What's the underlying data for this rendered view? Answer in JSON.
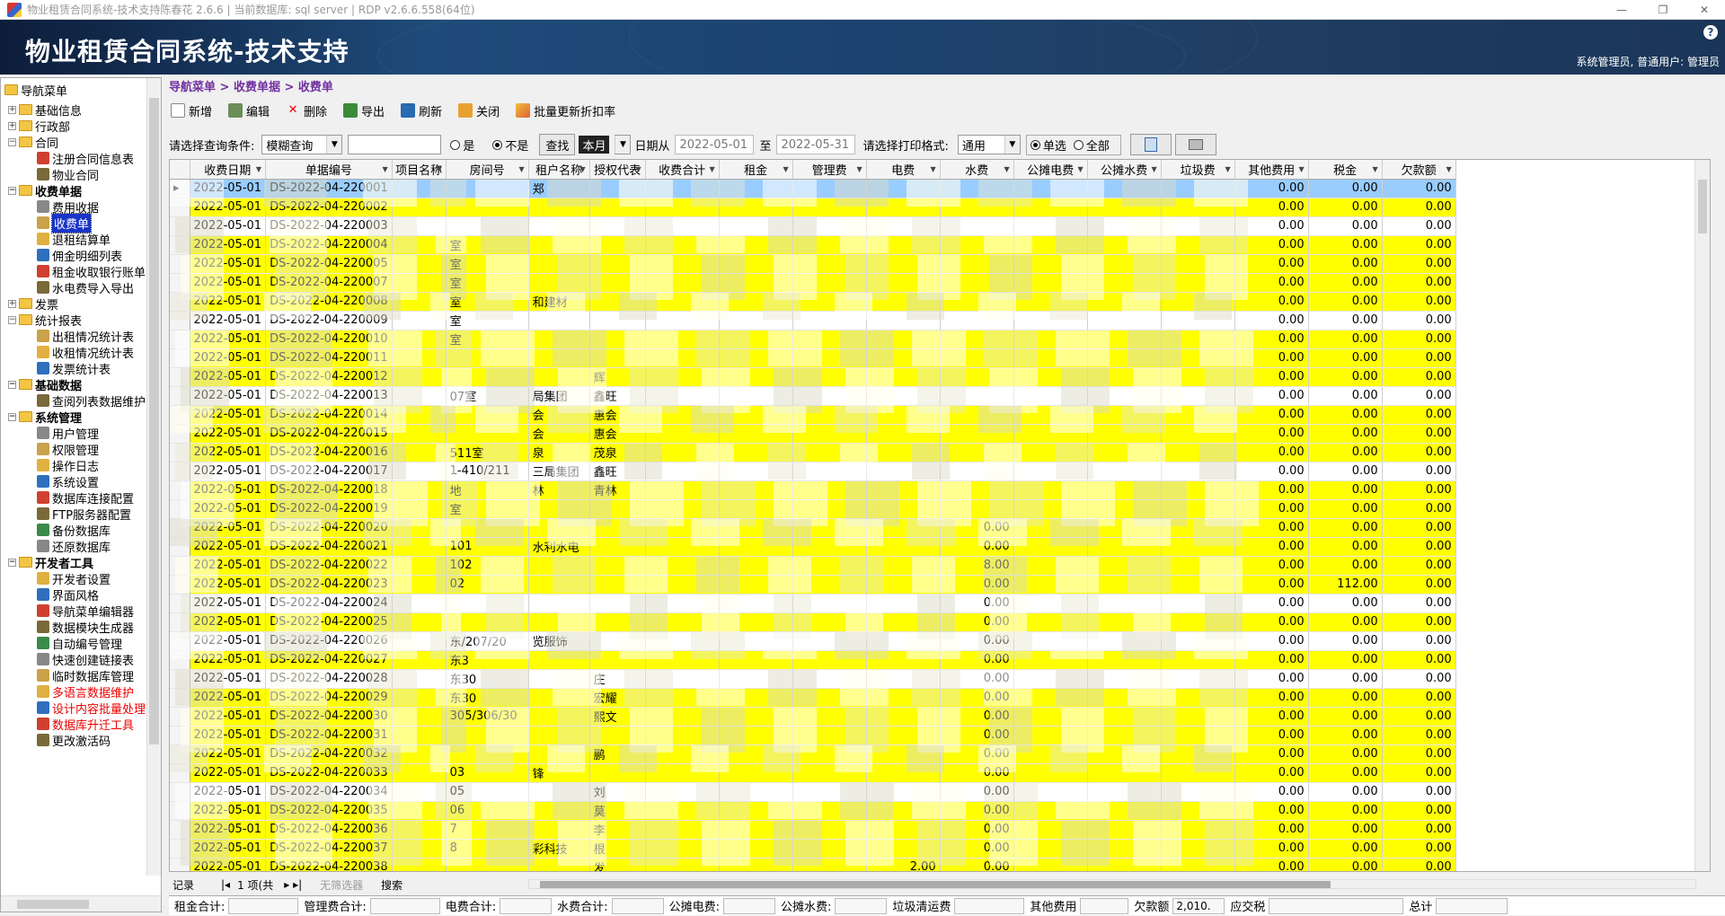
{
  "window": {
    "title": "物业租赁合同系统-技术支持陈春花 2.6.6 | 当前数据库: sql server | RDP v2.6.6.558(64位)"
  },
  "banner": {
    "title": "物业租赁合同系统-技术支持",
    "user_info": "系统管理员, 普通用户: 管理员"
  },
  "sidebar": {
    "root": "导航菜单",
    "items": [
      {
        "label": "基础信息",
        "level": 1,
        "type": "folder"
      },
      {
        "label": "行政部",
        "level": 1,
        "type": "folder"
      },
      {
        "label": "合同",
        "level": 1,
        "type": "folder"
      },
      {
        "label": "注册合同信息表",
        "level": 2,
        "type": "leaf"
      },
      {
        "label": "物业合同",
        "level": 2,
        "type": "leaf"
      },
      {
        "label": "收费单据",
        "level": 1,
        "type": "folder"
      },
      {
        "label": "费用收据",
        "level": 2,
        "type": "leaf"
      },
      {
        "label": "收费单",
        "level": 2,
        "type": "leaf",
        "selected": true
      },
      {
        "label": "退租结算单",
        "level": 2,
        "type": "leaf"
      },
      {
        "label": "佣金明细列表",
        "level": 2,
        "type": "leaf"
      },
      {
        "label": "租金收取银行账单",
        "level": 2,
        "type": "leaf"
      },
      {
        "label": "水电费导入导出",
        "level": 2,
        "type": "leaf"
      },
      {
        "label": "发票",
        "level": 1,
        "type": "folder"
      },
      {
        "label": "统计报表",
        "level": 1,
        "type": "folder"
      },
      {
        "label": "出租情况统计表",
        "level": 2,
        "type": "leaf"
      },
      {
        "label": "收租情况统计表",
        "level": 2,
        "type": "leaf"
      },
      {
        "label": "发票统计表",
        "level": 2,
        "type": "leaf"
      },
      {
        "label": "基础数据",
        "level": 1,
        "type": "folder"
      },
      {
        "label": "查阅列表数据维护",
        "level": 2,
        "type": "leaf"
      },
      {
        "label": "系统管理",
        "level": 1,
        "type": "folder"
      },
      {
        "label": "用户管理",
        "level": 2,
        "type": "leaf"
      },
      {
        "label": "权限管理",
        "level": 2,
        "type": "leaf"
      },
      {
        "label": "操作日志",
        "level": 2,
        "type": "leaf"
      },
      {
        "label": "系统设置",
        "level": 2,
        "type": "leaf"
      },
      {
        "label": "数据库连接配置",
        "level": 2,
        "type": "leaf"
      },
      {
        "label": "FTP服务器配置",
        "level": 2,
        "type": "leaf"
      },
      {
        "label": "备份数据库",
        "level": 2,
        "type": "leaf"
      },
      {
        "label": "还原数据库",
        "level": 2,
        "type": "leaf"
      },
      {
        "label": "开发者工具",
        "level": 1,
        "type": "folder"
      },
      {
        "label": "开发者设置",
        "level": 2,
        "type": "leaf"
      },
      {
        "label": "界面风格",
        "level": 2,
        "type": "leaf"
      },
      {
        "label": "导航菜单编辑器",
        "level": 2,
        "type": "leaf"
      },
      {
        "label": "数据模块生成器",
        "level": 2,
        "type": "leaf"
      },
      {
        "label": "自动编号管理",
        "level": 2,
        "type": "leaf"
      },
      {
        "label": "快速创建链接表",
        "level": 2,
        "type": "leaf"
      },
      {
        "label": "临时数据库管理",
        "level": 2,
        "type": "leaf"
      },
      {
        "label": "多语言数据维护",
        "level": 2,
        "type": "leaf",
        "red": true
      },
      {
        "label": "设计内容批量处理",
        "level": 2,
        "type": "leaf",
        "red": true
      },
      {
        "label": "数据库升迁工具",
        "level": 2,
        "type": "leaf",
        "red": true
      },
      {
        "label": "更改激活码",
        "level": 2,
        "type": "leaf"
      }
    ]
  },
  "breadcrumb": "导航菜单 > 收费单据 > 收费单",
  "toolbar": {
    "new": "新增",
    "edit": "编辑",
    "delete": "删除",
    "export": "导出",
    "refresh": "刷新",
    "close": "关闭",
    "batch": "批量更新折扣率"
  },
  "filter": {
    "label": "请选择查询条件:",
    "mode": "模糊查询",
    "search_value": "",
    "yes": "是",
    "no": "不是",
    "no_checked": true,
    "search_button": "查找",
    "this_month": "本月",
    "date_from_label": "日期从",
    "date_from": "2022-05-01",
    "date_to_label": "至",
    "date_to": "2022-05-31",
    "print_label": "请选择打印格式:",
    "print_format": "通用",
    "single": "单选",
    "all": "全部"
  },
  "grid": {
    "columns": [
      "收费日期",
      "单据编号",
      "项目名称",
      "房间号",
      "租户名称",
      "授权代表",
      "收费合计",
      "租金",
      "管理费",
      "电费",
      "水费",
      "公摊电费",
      "公摊水费",
      "垃圾费",
      "其他费用",
      "税金",
      "欠款额"
    ],
    "rows": [
      [
        "2022-05-01",
        "DS-2022-04-220001",
        "",
        "",
        "郑",
        "",
        "",
        "",
        "",
        "",
        "",
        "",
        "",
        "",
        "0.00",
        "0.00",
        "0.00"
      ],
      [
        "2022-05-01",
        "DS-2022-04-220002",
        "",
        "",
        "",
        "",
        "",
        "",
        "",
        "",
        "",
        "",
        "",
        "",
        "0.00",
        "0.00",
        "0.00"
      ],
      [
        "2022-05-01",
        "DS-2022-04-220003",
        "",
        "",
        "",
        "",
        "",
        "",
        "",
        "",
        "",
        "",
        "",
        "",
        "0.00",
        "0.00",
        "0.00"
      ],
      [
        "2022-05-01",
        "DS-2022-04-220004",
        "",
        "室",
        "",
        "",
        "",
        "",
        "",
        "",
        "",
        "",
        "",
        "",
        "0.00",
        "0.00",
        "0.00"
      ],
      [
        "2022-05-01",
        "DS-2022-04-220005",
        "",
        "室",
        "",
        "",
        "",
        "",
        "",
        "",
        "",
        "",
        "",
        "",
        "0.00",
        "0.00",
        "0.00"
      ],
      [
        "2022-05-01",
        "DS-2022-04-220007",
        "",
        "室",
        "",
        "",
        "",
        "",
        "",
        "",
        "",
        "",
        "",
        "",
        "0.00",
        "0.00",
        "0.00"
      ],
      [
        "2022-05-01",
        "DS-2022-04-220008",
        "",
        "室",
        "和建材",
        "",
        "",
        "",
        "",
        "",
        "",
        "",
        "",
        "",
        "0.00",
        "0.00",
        "0.00"
      ],
      [
        "2022-05-01",
        "DS-2022-04-220009",
        "",
        "室",
        "",
        "",
        "",
        "",
        "",
        "",
        "",
        "",
        "",
        "",
        "0.00",
        "0.00",
        "0.00"
      ],
      [
        "2022-05-01",
        "DS-2022-04-220010",
        "",
        "室",
        "",
        "",
        "",
        "",
        "",
        "",
        "",
        "",
        "",
        "",
        "0.00",
        "0.00",
        "0.00"
      ],
      [
        "2022-05-01",
        "DS-2022-04-220011",
        "",
        "",
        "",
        "",
        "",
        "",
        "",
        "",
        "",
        "",
        "",
        "",
        "0.00",
        "0.00",
        "0.00"
      ],
      [
        "2022-05-01",
        "DS-2022-04-220012",
        "",
        "",
        "",
        "辉",
        "",
        "",
        "",
        "",
        "",
        "",
        "",
        "",
        "0.00",
        "0.00",
        "0.00"
      ],
      [
        "2022-05-01",
        "DS-2022-04-220013",
        "",
        "07室",
        "局集团",
        "鑫旺",
        "",
        "",
        "",
        "",
        "",
        "",
        "",
        "",
        "0.00",
        "0.00",
        "0.00"
      ],
      [
        "2022-05-01",
        "DS-2022-04-220014",
        "",
        "",
        "会",
        "惠会",
        "",
        "",
        "",
        "",
        "",
        "",
        "",
        "",
        "0.00",
        "0.00",
        "0.00"
      ],
      [
        "2022-05-01",
        "DS-2022-04-220015",
        "",
        "",
        "会",
        "惠会",
        "",
        "",
        "",
        "",
        "",
        "",
        "",
        "",
        "0.00",
        "0.00",
        "0.00"
      ],
      [
        "2022-05-01",
        "DS-2022-04-220016",
        "",
        "511室",
        "泉",
        "茂泉",
        "",
        "",
        "",
        "",
        "",
        "",
        "",
        "",
        "0.00",
        "0.00",
        "0.00"
      ],
      [
        "2022-05-01",
        "DS-2022-04-220017",
        "",
        "1-410/211",
        "三局集团",
        "鑫旺",
        "",
        "",
        "",
        "",
        "",
        "",
        "",
        "",
        "0.00",
        "0.00",
        "0.00"
      ],
      [
        "2022-05-01",
        "DS-2022-04-220018",
        "",
        "地",
        "林",
        "青林",
        "",
        "",
        "",
        "",
        "",
        "",
        "",
        "",
        "0.00",
        "0.00",
        "0.00"
      ],
      [
        "2022-05-01",
        "DS-2022-04-220019",
        "",
        "室",
        "",
        "",
        "",
        "",
        "",
        "",
        "",
        "",
        "",
        "",
        "0.00",
        "0.00",
        "0.00"
      ],
      [
        "2022-05-01",
        "DS-2022-04-220020",
        "",
        "",
        "",
        "",
        "",
        "",
        "",
        "",
        "0.00",
        "",
        "",
        "",
        "0.00",
        "0.00",
        "0.00"
      ],
      [
        "2022-05-01",
        "DS-2022-04-220021",
        "",
        "101",
        "水利水电",
        "",
        "",
        "",
        "",
        "",
        "0.00",
        "",
        "",
        "",
        "0.00",
        "0.00",
        "0.00"
      ],
      [
        "2022-05-01",
        "DS-2022-04-220022",
        "",
        "102",
        "",
        "",
        "",
        "",
        "",
        "",
        "8.00",
        "",
        "",
        "",
        "0.00",
        "0.00",
        "0.00"
      ],
      [
        "2022-05-01",
        "DS-2022-04-220023",
        "",
        "02",
        "",
        "",
        "",
        "",
        "",
        "",
        "0.00",
        "",
        "",
        "",
        "0.00",
        "112.00",
        "0.00"
      ],
      [
        "2022-05-01",
        "DS-2022-04-220024",
        "",
        "",
        "",
        "",
        "",
        "",
        "",
        "",
        "0.00",
        "",
        "",
        "",
        "0.00",
        "0.00",
        "0.00"
      ],
      [
        "2022-05-01",
        "DS-2022-04-220025",
        "",
        "",
        "",
        "",
        "",
        "",
        "",
        "",
        "0.00",
        "",
        "",
        "",
        "0.00",
        "0.00",
        "0.00"
      ],
      [
        "2022-05-01",
        "DS-2022-04-220026",
        "",
        "东/207/20",
        "览服饰",
        "",
        "",
        "",
        "",
        "",
        "0.00",
        "",
        "",
        "",
        "0.00",
        "0.00",
        "0.00"
      ],
      [
        "2022-05-01",
        "DS-2022-04-220027",
        "",
        "东3",
        "",
        "",
        "",
        "",
        "",
        "",
        "0.00",
        "",
        "",
        "",
        "0.00",
        "0.00",
        "0.00"
      ],
      [
        "2022-05-01",
        "DS-2022-04-220028",
        "",
        "东30",
        "",
        "庄",
        "",
        "",
        "",
        "",
        "0.00",
        "",
        "",
        "",
        "0.00",
        "0.00",
        "0.00"
      ],
      [
        "2022-05-01",
        "DS-2022-04-220029",
        "",
        "东30",
        "",
        "宏耀",
        "",
        "",
        "",
        "",
        "0.00",
        "",
        "",
        "",
        "0.00",
        "0.00",
        "0.00"
      ],
      [
        "2022-05-01",
        "DS-2022-04-220030",
        "",
        "305/306/30",
        "",
        "熙文",
        "",
        "",
        "",
        "",
        "0.00",
        "",
        "",
        "",
        "0.00",
        "0.00",
        "0.00"
      ],
      [
        "2022-05-01",
        "DS-2022-04-220031",
        "",
        "",
        "",
        "",
        "",
        "",
        "",
        "",
        "0.00",
        "",
        "",
        "",
        "0.00",
        "0.00",
        "0.00"
      ],
      [
        "2022-05-01",
        "DS-2022-04-220032",
        "",
        "",
        "",
        "鹏",
        "",
        "",
        "",
        "",
        "0.00",
        "",
        "",
        "",
        "0.00",
        "0.00",
        "0.00"
      ],
      [
        "2022-05-01",
        "DS-2022-04-220033",
        "",
        "03",
        "锋",
        "",
        "",
        "",
        "",
        "",
        "0.00",
        "",
        "",
        "",
        "0.00",
        "0.00",
        "0.00"
      ],
      [
        "2022-05-01",
        "DS-2022-04-220034",
        "",
        "05",
        "",
        "刘",
        "",
        "",
        "",
        "",
        "0.00",
        "",
        "",
        "",
        "0.00",
        "0.00",
        "0.00"
      ],
      [
        "2022-05-01",
        "DS-2022-04-220035",
        "",
        "06",
        "",
        "莫",
        "",
        "",
        "",
        "",
        "0.00",
        "",
        "",
        "",
        "0.00",
        "0.00",
        "0.00"
      ],
      [
        "2022-05-01",
        "DS-2022-04-220036",
        "",
        "7",
        "",
        "李",
        "",
        "",
        "",
        "",
        "0.00",
        "",
        "",
        "",
        "0.00",
        "0.00",
        "0.00"
      ],
      [
        "2022-05-01",
        "DS-2022-04-220037",
        "",
        "8",
        "彩科技",
        "根",
        "",
        "",
        "",
        "",
        "0.00",
        "",
        "",
        "",
        "0.00",
        "0.00",
        "0.00"
      ],
      [
        "2022-05-01",
        "DS-2022-04-220038",
        "",
        "",
        "",
        "发",
        "",
        "",
        "",
        "2.00",
        "0.00",
        "",
        "",
        "",
        "0.00",
        "0.00",
        "0.00"
      ]
    ],
    "row_colors": [
      "s",
      "y",
      "w",
      "y",
      "y",
      "y",
      "y",
      "w",
      "y",
      "y",
      "y",
      "w",
      "y",
      "y",
      "y",
      "w",
      "y",
      "y",
      "y",
      "y",
      "y",
      "y",
      "w",
      "y",
      "w",
      "y",
      "w",
      "y",
      "y",
      "y",
      "y",
      "y",
      "w",
      "y",
      "y",
      "y",
      "y"
    ]
  },
  "navbar": {
    "record": "记录",
    "page_info": "1 项(共",
    "filter_label": "无筛选器",
    "search": "搜索"
  },
  "summary": {
    "rent_total": "租金合计:",
    "mgmt_total": "管理费合计:",
    "elec_total": "电费合计:",
    "water_total": "水费合计:",
    "shared_elec": "公摊电费:",
    "shared_water": "公摊水费:",
    "garbage": "垃圾清运费",
    "other": "其他费用",
    "arrears": "欠款额",
    "arrears_value": "2,010.",
    "tax_due": "应交税",
    "grand_total": "总计"
  }
}
